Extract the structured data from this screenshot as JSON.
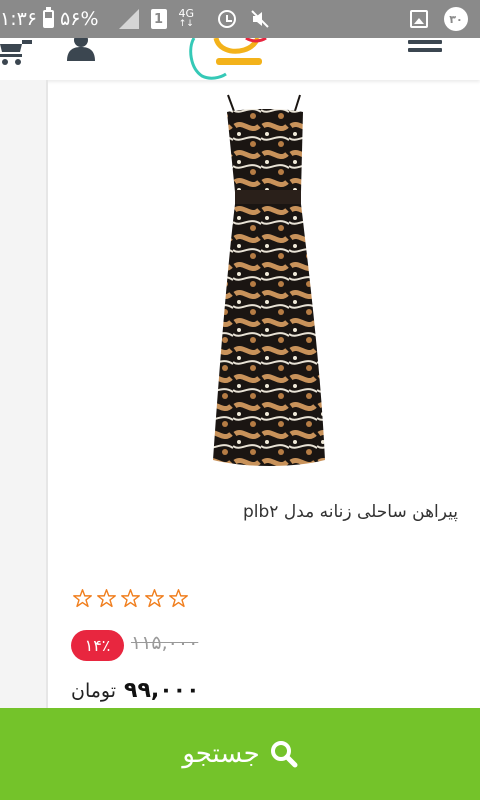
{
  "status_bar": {
    "time": "۱:۳۶",
    "battery": "۵۶%",
    "sim": "1",
    "network": "4G",
    "notification_count": "۳۰"
  },
  "header": {
    "logo_icon": "store-logo-icon",
    "icons": [
      "cart-icon",
      "user-icon",
      "menu-icon"
    ]
  },
  "product": {
    "title": "پیراهن ساحلی زنانه مدل plb۲",
    "rating_stars": 5,
    "rating_value": 0,
    "discount": "۱۴٪",
    "old_price": "۱۱۵,۰۰۰",
    "price": "۹۹,۰۰۰",
    "currency": "تومان"
  },
  "search_bar": {
    "label": "جستجو"
  },
  "colors": {
    "status_bar": "#8a8a8a",
    "search_bar": "#74c32a",
    "discount": "#e8263f",
    "star_outline": "#f07f1f",
    "dark_icon": "#3b4650"
  }
}
